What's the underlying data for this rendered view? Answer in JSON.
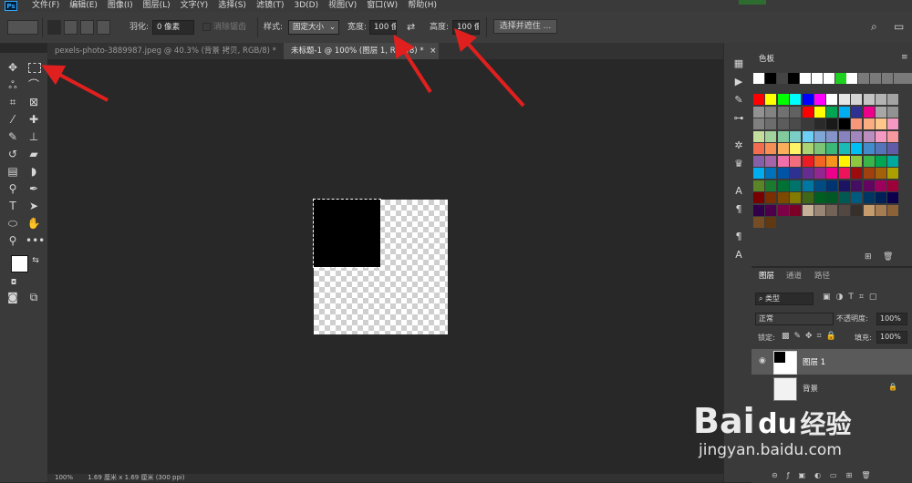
{
  "app": {
    "logo": "Ps"
  },
  "menu": [
    "文件(F)",
    "编辑(E)",
    "图像(I)",
    "图层(L)",
    "文字(Y)",
    "选择(S)",
    "滤镜(T)",
    "3D(D)",
    "视图(V)",
    "窗口(W)",
    "帮助(H)"
  ],
  "options": {
    "feather_label": "羽化:",
    "feather_value": "0 像素",
    "antialias_label": "消除锯齿",
    "style_label": "样式:",
    "style_value": "固定大小",
    "width_label": "宽度:",
    "width_value": "100 像",
    "height_label": "高度:",
    "height_value": "100 像",
    "select_mask_button": "选择并遮住 ..."
  },
  "tabs": [
    {
      "label": "pexels-photo-3889987.jpeg @ 40.3% (背景 拷贝, RGB/8) *",
      "close": "×",
      "active": false
    },
    {
      "label": "未标题-1 @ 100% (图层 1, RGB/8) *",
      "close": "×",
      "active": true
    }
  ],
  "status": {
    "zoom": "100%",
    "doc_info": "1.69 厘米 x 1.69 厘米 (300 ppi)"
  },
  "swatches_panel": {
    "title": "色板",
    "row0": [
      "#ffffff",
      "#000000",
      "#444444",
      "#000000",
      "#ffffff",
      "#ffffff",
      "#ffffff",
      "#1fd11f",
      "#ffffff",
      "#7a7a7a",
      "#7a7a7a",
      "#7a7a7a",
      "#7a7a7a",
      "#7a7a7a"
    ],
    "rows": [
      [
        "#ff0000",
        "#ffff00",
        "#00ff00",
        "#00ffff",
        "#0000ff",
        "#ff00ff",
        "#ffffff",
        "#e5e5e5",
        "#d4d4d4",
        "#c4c4c4",
        "#b3b3b3",
        "#a3a3a3"
      ],
      [
        "#929292",
        "#828282",
        "#717171",
        "#616161",
        "#ff0000",
        "#ffff00",
        "#00a651",
        "#00aeef",
        "#2e3192",
        "#ec008c",
        "#a7a7a7",
        "#929292"
      ],
      [
        "#7f7f7f",
        "#6d6d6d",
        "#5c5c5c",
        "#4b4b4b",
        "#3a3a3a",
        "#2a2a2a",
        "#191919",
        "#000000",
        "#f7977a",
        "#f9ad81",
        "#fdc68a",
        "#f49ac2"
      ],
      [
        "#c4df9b",
        "#a2d39c",
        "#82ca9d",
        "#7bcdc8",
        "#6ecff6",
        "#7ea7d8",
        "#8493ca",
        "#8882be",
        "#a187be",
        "#bc8dbf",
        "#f49ac2",
        "#f6989d"
      ],
      [
        "#f26c4f",
        "#f68e55",
        "#fbaf5c",
        "#fff467",
        "#acd372",
        "#7cc576",
        "#3bb878",
        "#1abbb4",
        "#00bff3",
        "#438ccb",
        "#5574b9",
        "#605ca8"
      ],
      [
        "#855fa8",
        "#a763a8",
        "#f06eaa",
        "#f26d7d",
        "#ed1c24",
        "#f26522",
        "#f7941d",
        "#fff200",
        "#8dc63f",
        "#39b54a",
        "#00a651",
        "#00a99d"
      ],
      [
        "#00aeef",
        "#0072bc",
        "#0054a6",
        "#2e3192",
        "#662d91",
        "#92278f",
        "#ec008c",
        "#ed145b",
        "#9e0b0f",
        "#a0410d",
        "#a36209",
        "#aba000"
      ],
      [
        "#598527",
        "#1a7b30",
        "#007236",
        "#00746b",
        "#0076a3",
        "#004b80",
        "#003471",
        "#1b1464",
        "#440e62",
        "#630460",
        "#9e005d",
        "#9e0039"
      ],
      [
        "#790000",
        "#7b2e00",
        "#7d4900",
        "#827b00",
        "#406618",
        "#005e20",
        "#005826",
        "#005952",
        "#005b7f",
        "#003663",
        "#002157",
        "#0d004c"
      ],
      [
        "#32004b",
        "#4b0049",
        "#7b0046",
        "#7a0026",
        "#c7b299",
        "#998675",
        "#736357",
        "#534741",
        "#37302a",
        "#c69c6d",
        "#a67c52",
        "#8c6239"
      ],
      [
        "#754c24",
        "#603913"
      ]
    ]
  },
  "layers_panel": {
    "tabs": [
      "图层",
      "通道",
      "路径"
    ],
    "filter_label": "类型",
    "blend_mode": "正常",
    "opacity_label": "不透明度:",
    "opacity_value": "100%",
    "lock_label": "锁定:",
    "fill_label": "填充:",
    "fill_value": "100%",
    "layers": [
      {
        "name": "图层 1",
        "selected": true
      },
      {
        "name": "背景",
        "selected": false
      }
    ],
    "footer_icons": [
      "link-icon",
      "fx-icon",
      "mask-icon",
      "adjustment-icon",
      "group-icon",
      "new-layer-icon",
      "trash-icon"
    ]
  },
  "annotations": {
    "arrow_color": "#e0201e"
  },
  "watermark": {
    "brand": "Bai",
    "brand2": "经验",
    "url": "jingyan.baidu.com"
  }
}
